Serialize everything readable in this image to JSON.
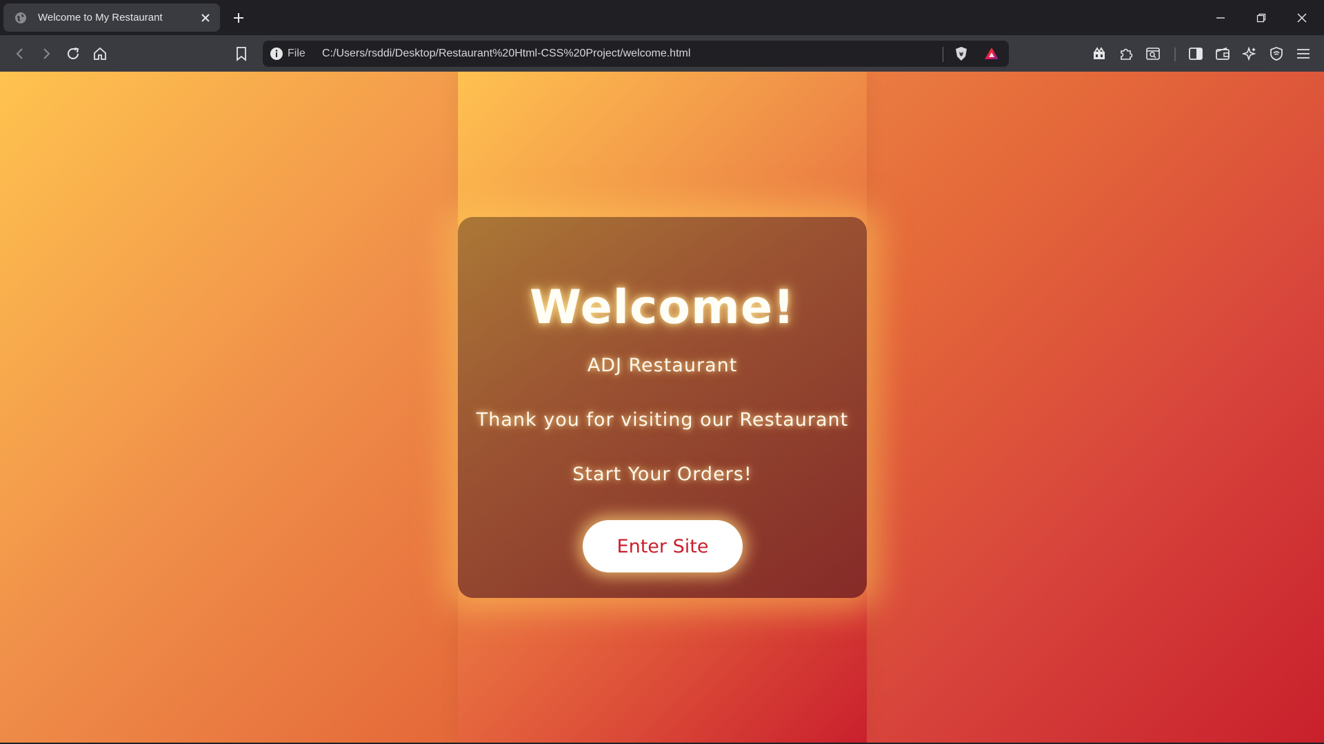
{
  "browser": {
    "tab_title": "Welcome to My Restaurant",
    "new_tab_symbol": "+",
    "address_scheme": "File",
    "address_url": "C:/Users/rsddi/Desktop/Restaurant%20Html-CSS%20Project/welcome.html",
    "icons": {
      "favicon": "globe-icon",
      "back": "back-arrow-icon",
      "forward": "forward-arrow-icon",
      "reload": "reload-icon",
      "home": "home-icon",
      "bookmark": "bookmark-icon",
      "info": "info-icon",
      "brave_shield": "brave-shield-icon",
      "rewards": "brave-rewards-icon",
      "toolbar_right": [
        "leo-ai-icon",
        "extensions-icon",
        "screenshot-icon",
        "sidebar-icon",
        "wallet-icon",
        "sparkle-icon",
        "vpn-icon",
        "menu-icon"
      ]
    }
  },
  "page": {
    "heading": "Welcome!",
    "restaurant_name": "ADJ Restaurant",
    "thank_you": "Thank you for visiting our Restaurant",
    "call_to_action": "Start Your Orders!",
    "enter_button": "Enter Site"
  },
  "colors": {
    "gradient_start": "#ffc34f",
    "gradient_end": "#c8202c",
    "button_text": "#c8202c",
    "card": "#9a5232"
  }
}
